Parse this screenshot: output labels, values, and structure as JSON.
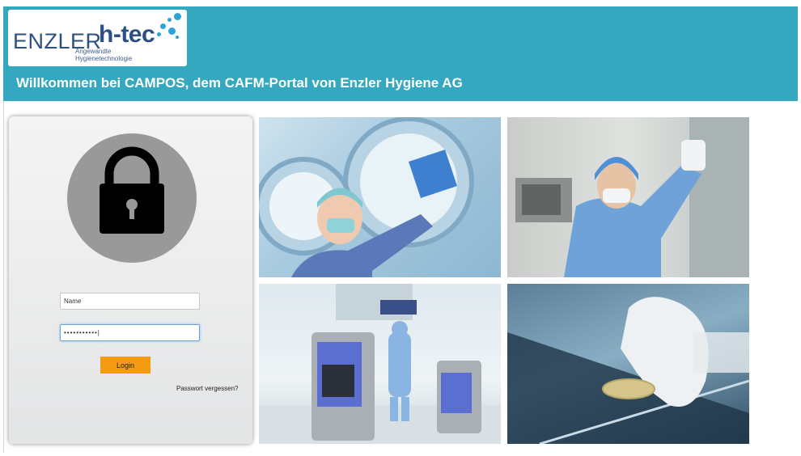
{
  "header": {
    "logo": {
      "brand_left": "ENZLER",
      "brand_right": "h-tec",
      "tagline_line1": "Angewandte",
      "tagline_line2": "Hygienetechnologie"
    },
    "welcome": "Willkommen bei CAMPOS, dem CAFM-Portal von Enzler Hygiene AG"
  },
  "login": {
    "name_value": "Name",
    "password_value": "•••••••••••|",
    "login_label": "Login",
    "forgot_label": "Passwort vergessen?"
  },
  "gallery": {
    "images": [
      "surgical-lights-cleaning-photo",
      "cleanroom-worker-photo",
      "decontamination-units-photo",
      "petri-dish-gloves-photo"
    ]
  },
  "colors": {
    "header_bg": "#35a8c0",
    "brand_blue": "#2c4f86",
    "login_button": "#f39c12",
    "lock_circle": "#999999"
  }
}
